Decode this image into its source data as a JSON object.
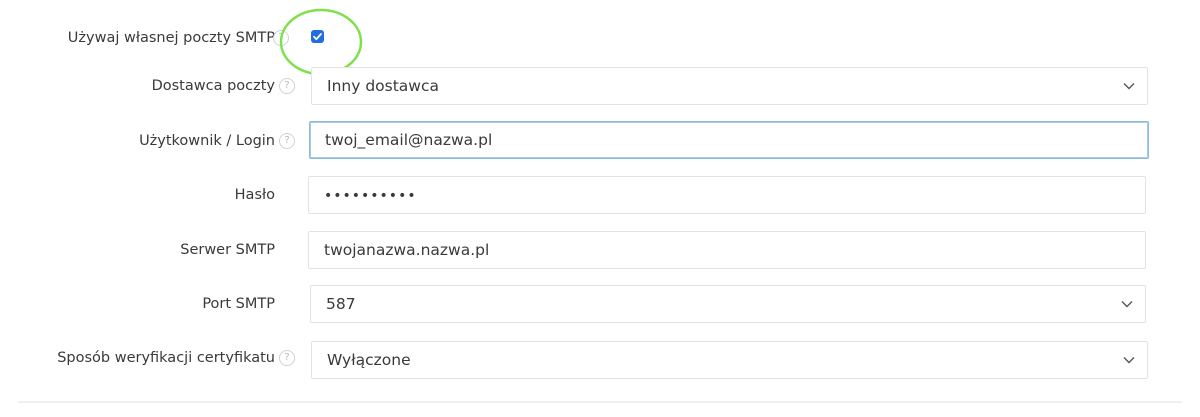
{
  "smtp": {
    "use_own_label": "Używaj własnej poczty SMTP",
    "use_own_checked": true,
    "provider_label": "Dostawca poczty",
    "provider_value": "Inny dostawca",
    "user_label": "Użytkownik / Login",
    "user_value": "twoj_email@nazwa.pl",
    "password_label": "Hasło",
    "password_value": "••••••••••",
    "server_label": "Serwer SMTP",
    "server_value": "twojanazwa.nazwa.pl",
    "port_label": "Port SMTP",
    "port_value": "587",
    "cert_label": "Sposób weryfikacji certyfikatu",
    "cert_value": "Wyłączone"
  },
  "help_glyph": "?",
  "icons": {
    "help": "question-circle-icon",
    "dropdown": "chevron-down-icon",
    "check": "checkmark-icon"
  },
  "colors": {
    "checkbox": "#1f6fe0",
    "annotation_circle": "#7ee04a",
    "focus_border": "#8db9d8"
  }
}
